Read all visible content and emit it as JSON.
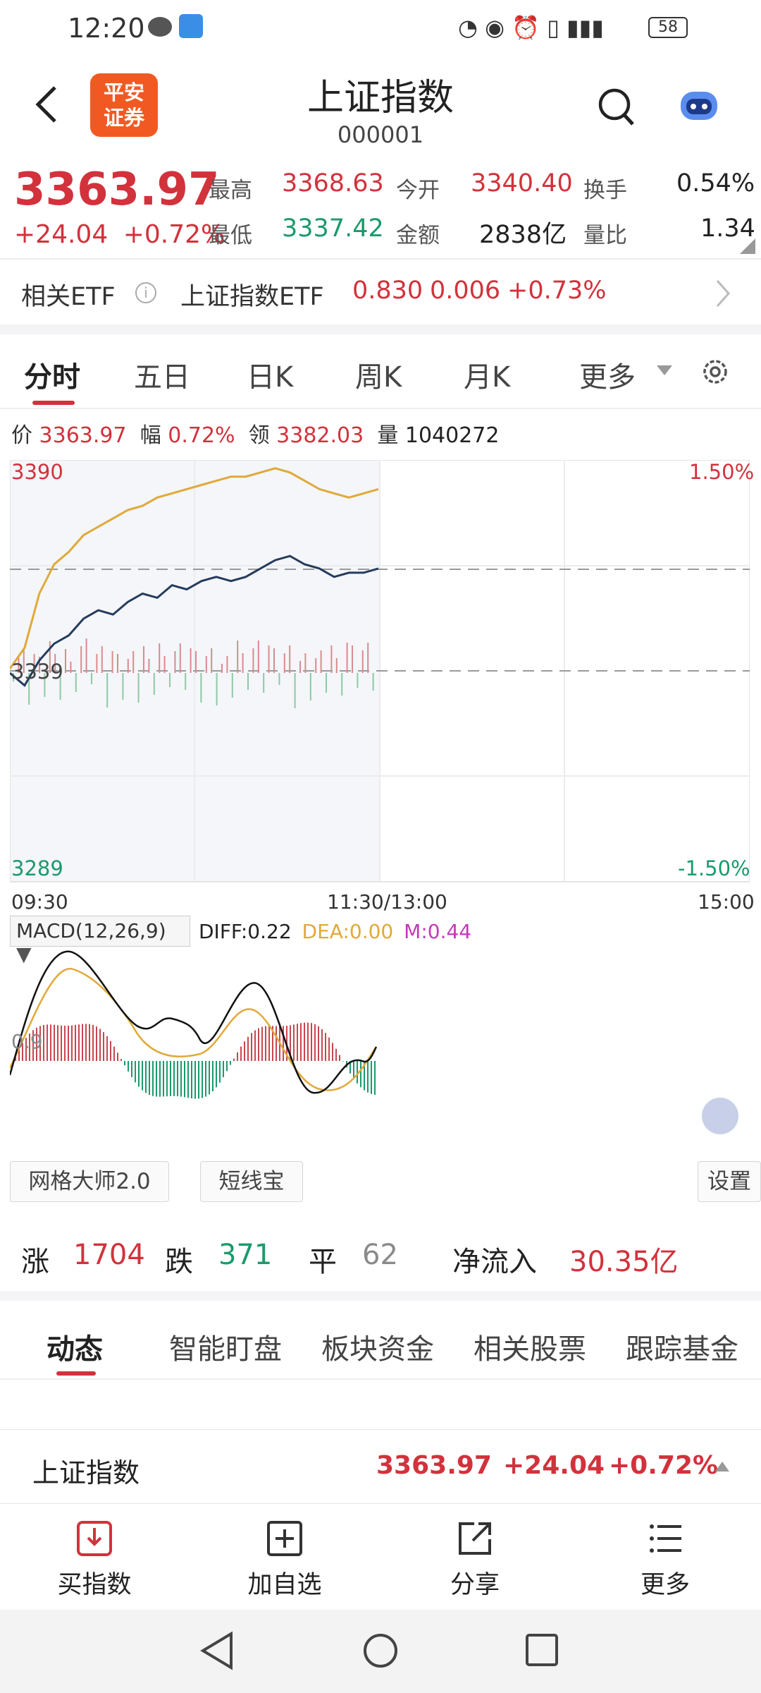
{
  "status_bar": {
    "time": "12:20",
    "battery": "58"
  },
  "header": {
    "logo_line1": "平安",
    "logo_line2": "证券",
    "title": "上证指数",
    "code": "000001"
  },
  "quote": {
    "price": "3363.97",
    "change": "+24.04",
    "change_pct": "+0.72%",
    "high_label": "最高",
    "high": "3368.63",
    "low_label": "最低",
    "low": "3337.42",
    "open_label": "今开",
    "open": "3340.40",
    "amount_label": "金额",
    "amount": "2838亿",
    "turnover_label": "换手",
    "turnover": "0.54%",
    "vol_ratio_label": "量比",
    "vol_ratio": "1.34"
  },
  "etf": {
    "label": "相关ETF",
    "name": "上证指数ETF",
    "price": "0.830",
    "change": "0.006",
    "change_pct": "+0.73%"
  },
  "tabs": [
    "分时",
    "五日",
    "日K",
    "周K",
    "月K",
    "更多"
  ],
  "chart_info": {
    "price_label": "价",
    "price": "3363.97",
    "amp_label": "幅",
    "amp": "0.72%",
    "lead_label": "领",
    "lead": "3382.03",
    "vol_label": "量",
    "vol": "1040272"
  },
  "chart": {
    "y_top": "3390",
    "y_bottom": "3289",
    "y_mid": "3339",
    "pct_top": "1.50%",
    "pct_bottom": "-1.50%",
    "t_start": "09:30",
    "t_mid": "11:30/13:00",
    "t_end": "15:00"
  },
  "macd": {
    "label": "MACD(12,26,9)",
    "diff": "DIFF:0.22",
    "dea": "DEA:0.00",
    "m": "M:0.44",
    "axis_label": "0.9"
  },
  "tools_row": {
    "grid": "网格大师2.0",
    "short": "短线宝",
    "settings": "设置"
  },
  "breadth": {
    "up_label": "涨",
    "up": "1704",
    "down_label": "跌",
    "down": "371",
    "flat_label": "平",
    "flat": "62",
    "inflow_label": "净流入",
    "inflow": "30.35亿"
  },
  "bottom_tabs": [
    "动态",
    "智能盯盘",
    "板块资金",
    "相关股票",
    "跟踪基金"
  ],
  "footer_quote": {
    "name": "上证指数",
    "price": "3363.97",
    "change": "+24.04",
    "change_pct": "+0.72%"
  },
  "toolbar": [
    "买指数",
    "加自选",
    "分享",
    "更多"
  ],
  "chart_data": {
    "type": "line",
    "title": "",
    "ylim": [
      3289,
      3390
    ],
    "ref_price": 3339,
    "x_range": [
      "09:30",
      "15:00"
    ],
    "series": [
      {
        "values": [
          3339,
          3336,
          3342,
          3346,
          3348,
          3352,
          3354,
          3353,
          3356,
          3358,
          3357,
          3360,
          3359,
          3361,
          3362,
          3361,
          3362,
          3364,
          3366,
          3367,
          3365,
          3364,
          3362,
          3363,
          3363,
          3364
        ]
      },
      {
        "values": [
          3340,
          3345,
          3358,
          3365,
          3368,
          3372,
          3374,
          3376,
          3378,
          3379,
          3381,
          3382,
          3383,
          3384,
          3385,
          3386,
          3386,
          3387,
          3388,
          3387,
          3385,
          3383,
          3382,
          3381,
          3382,
          3383
        ]
      }
    ]
  }
}
